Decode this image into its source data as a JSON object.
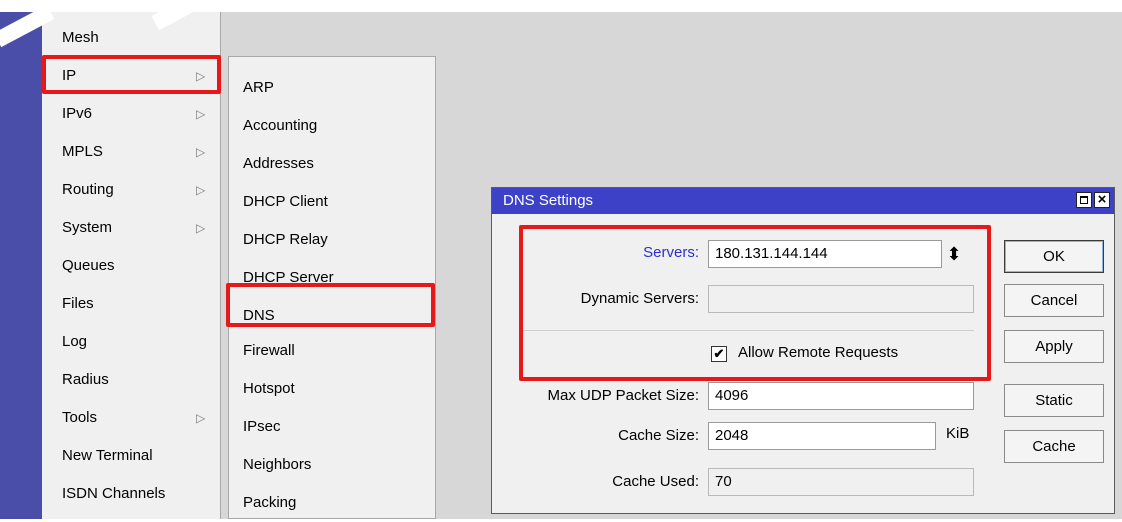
{
  "main_menu": {
    "items": [
      {
        "label": "Mesh",
        "has_submenu": false
      },
      {
        "label": "IP",
        "has_submenu": true,
        "highlighted": true
      },
      {
        "label": "IPv6",
        "has_submenu": true
      },
      {
        "label": "MPLS",
        "has_submenu": true
      },
      {
        "label": "Routing",
        "has_submenu": true
      },
      {
        "label": "System",
        "has_submenu": true
      },
      {
        "label": "Queues",
        "has_submenu": false
      },
      {
        "label": "Files",
        "has_submenu": false
      },
      {
        "label": "Log",
        "has_submenu": false
      },
      {
        "label": "Radius",
        "has_submenu": false
      },
      {
        "label": "Tools",
        "has_submenu": true
      },
      {
        "label": "New Terminal",
        "has_submenu": false
      },
      {
        "label": "ISDN Channels",
        "has_submenu": false
      }
    ],
    "submenu_arrow": "▷"
  },
  "ip_submenu": {
    "items": [
      {
        "label": "ARP"
      },
      {
        "label": "Accounting"
      },
      {
        "label": "Addresses"
      },
      {
        "label": "DHCP Client"
      },
      {
        "label": "DHCP Relay"
      },
      {
        "label": "DHCP Server"
      },
      {
        "label": "DNS",
        "highlighted": true
      },
      {
        "label": "Firewall"
      },
      {
        "label": "Hotspot"
      },
      {
        "label": "IPsec"
      },
      {
        "label": "Neighbors"
      },
      {
        "label": "Packing"
      }
    ]
  },
  "dns_dialog": {
    "title": "DNS Settings",
    "fields": {
      "servers": {
        "label": "Servers:",
        "value": "180.131.144.144"
      },
      "dynamic_servers": {
        "label": "Dynamic Servers:",
        "value": ""
      },
      "max_udp": {
        "label": "Max UDP Packet Size:",
        "value": "4096"
      },
      "cache_size": {
        "label": "Cache Size:",
        "value": "2048",
        "unit": "KiB"
      },
      "cache_used": {
        "label": "Cache Used:",
        "value": "70"
      }
    },
    "allow_remote": {
      "label": "Allow Remote Requests",
      "checked": true,
      "check_glyph": "✔"
    },
    "buttons": {
      "ok": "OK",
      "cancel": "Cancel",
      "apply": "Apply",
      "static": "Static",
      "cache": "Cache"
    },
    "spinner_glyph": "⬍",
    "close_glyph": "×"
  },
  "colors": {
    "highlight_border": "#e8171a",
    "titlebar": "#3d41c7",
    "link_label": "#2b2fd0",
    "left_strip": "#4a4ea8"
  }
}
